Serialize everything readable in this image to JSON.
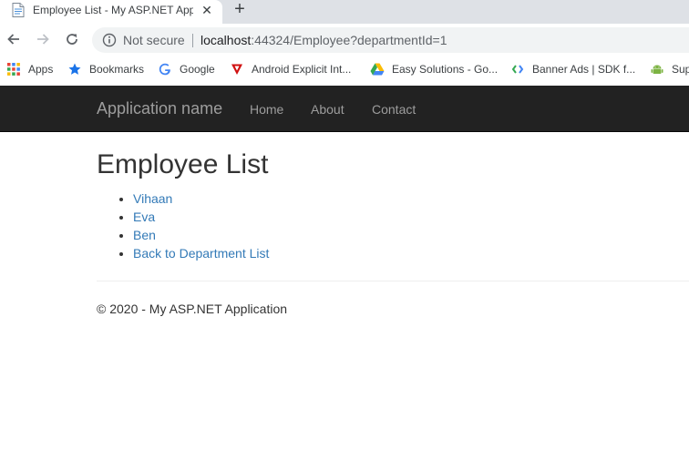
{
  "browser": {
    "tab_title": "Employee List - My ASP.NET Application",
    "tab_close": "✕",
    "new_tab": "+",
    "security_label": "Not secure",
    "url_host": "localhost",
    "url_rest": ":44324/Employee?departmentId=1"
  },
  "bookmarks": [
    {
      "label": "Apps",
      "icon": "apps-grid-icon"
    },
    {
      "label": "Bookmarks",
      "icon": "star-icon"
    },
    {
      "label": "Google",
      "icon": "google-icon"
    },
    {
      "label": "Android Explicit Int...",
      "icon": "triangle-icon"
    },
    {
      "label": "Easy Solutions - Go...",
      "icon": "drive-icon"
    },
    {
      "label": "Banner Ads  |  SDK f...",
      "icon": "ads-icon"
    },
    {
      "label": "Sup",
      "icon": "android-icon"
    }
  ],
  "navbar": {
    "brand": "Application name",
    "links": [
      "Home",
      "About",
      "Contact"
    ]
  },
  "main": {
    "title": "Employee List",
    "employees": [
      "Vihaan",
      "Eva",
      "Ben"
    ],
    "back_link": "Back to Department List"
  },
  "footer": {
    "text": "© 2020 - My ASP.NET Application"
  }
}
